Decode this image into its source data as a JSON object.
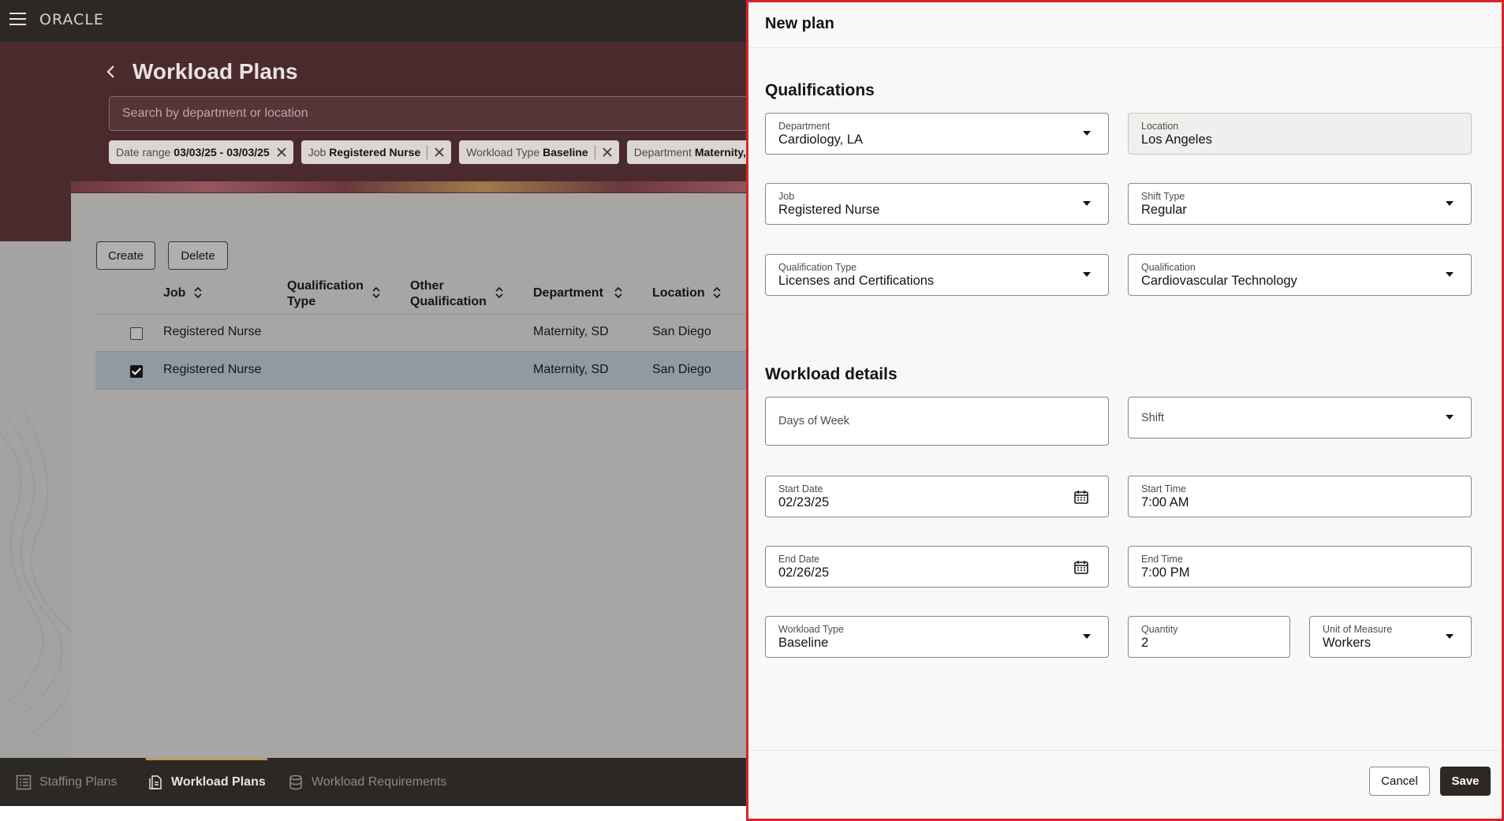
{
  "header": {
    "logo_text": "ORACLE"
  },
  "page": {
    "title": "Workload Plans"
  },
  "search": {
    "placeholder": "Search by department or location",
    "value": ""
  },
  "filters": [
    {
      "label": "Date range",
      "value": "03/03/25 - 03/03/25"
    },
    {
      "label": "Job",
      "value": "Registered Nurse"
    },
    {
      "label": "Workload Type",
      "value": "Baseline"
    },
    {
      "label": "Department",
      "value": "Maternity, SD"
    }
  ],
  "toolbar": {
    "create_label": "Create",
    "delete_label": "Delete"
  },
  "table": {
    "columns": [
      "Job",
      "Qualification Type",
      "Other Qualification",
      "Department",
      "Location"
    ],
    "column_lines": [
      [
        "Job"
      ],
      [
        "Qualification",
        "Type"
      ],
      [
        "Other",
        "Qualification"
      ],
      [
        "Department"
      ],
      [
        "Location"
      ]
    ],
    "rows": [
      {
        "checked": false,
        "job": "Registered Nurse",
        "qualification_type": "",
        "other_qualification": "",
        "department": "Maternity, SD",
        "location": "San Diego"
      },
      {
        "checked": true,
        "job": "Registered Nurse",
        "qualification_type": "",
        "other_qualification": "",
        "department": "Maternity, SD",
        "location": "San Diego"
      }
    ]
  },
  "bottom_nav": {
    "items": [
      {
        "label": "Staffing Plans",
        "active": false
      },
      {
        "label": "Workload Plans",
        "active": true
      },
      {
        "label": "Workload Requirements",
        "active": false
      }
    ]
  },
  "drawer": {
    "title": "New plan",
    "qualifications": {
      "heading": "Qualifications",
      "department": {
        "label": "Department",
        "value": "Cardiology, LA"
      },
      "location": {
        "label": "Location",
        "value": "Los Angeles"
      },
      "job": {
        "label": "Job",
        "value": "Registered Nurse"
      },
      "shift_type": {
        "label": "Shift Type",
        "value": "Regular"
      },
      "qualification_type": {
        "label": "Qualification Type",
        "value": "Licenses and Certifications"
      },
      "qualification": {
        "label": "Qualification",
        "value": "Cardiovascular Technology"
      }
    },
    "workload": {
      "heading": "Workload details",
      "days_of_week": {
        "label": "Days of Week",
        "value": ""
      },
      "shift": {
        "label": "Shift",
        "value": ""
      },
      "start_date": {
        "label": "Start Date",
        "value": "02/23/25"
      },
      "start_time": {
        "label": "Start Time",
        "value": "7:00 AM"
      },
      "end_date": {
        "label": "End Date",
        "value": "02/26/25"
      },
      "end_time": {
        "label": "End Time",
        "value": "7:00 PM"
      },
      "workload_type": {
        "label": "Workload Type",
        "value": "Baseline"
      },
      "quantity": {
        "label": "Quantity",
        "value": "2"
      },
      "unit_of_measure": {
        "label": "Unit of Measure",
        "value": "Workers"
      }
    },
    "cancel_label": "Cancel",
    "save_label": "Save"
  },
  "colors": {
    "brand_dark": "#2b2826",
    "hero": "#4a2a2d",
    "accent_gold": "#b99d58",
    "highlight_border": "#d9232a",
    "selected_row": "#8f9aa2"
  }
}
